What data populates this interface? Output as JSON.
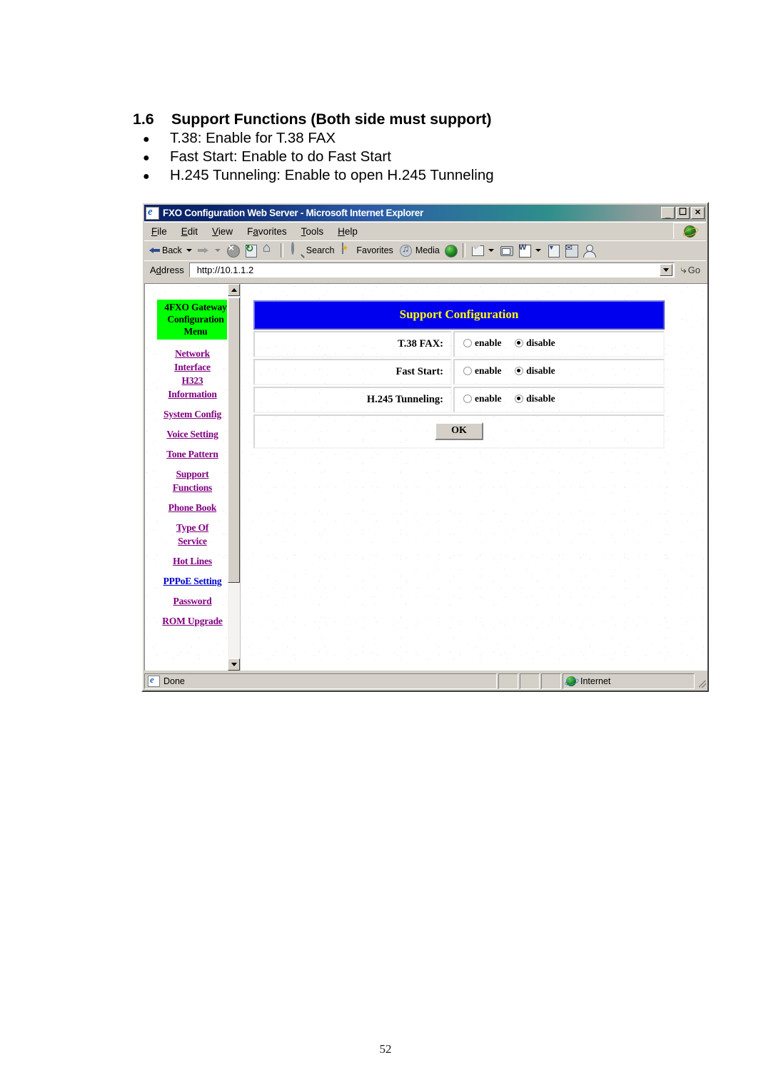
{
  "document": {
    "section_number": "1.6",
    "section_title": "Support Functions (Both side must support)",
    "bullets": [
      "T.38: Enable for T.38 FAX",
      "Fast Start: Enable to do Fast Start",
      "H.245 Tunneling: Enable to open H.245 Tunneling"
    ],
    "page_number": "52"
  },
  "browser": {
    "title": "FXO Configuration Web Server - Microsoft Internet Explorer",
    "window_buttons": {
      "minimize": "_",
      "maximize": "□",
      "close": "×"
    },
    "menu": [
      {
        "label": "File",
        "accel": "F",
        "rest": "ile"
      },
      {
        "label": "Edit",
        "accel": "E",
        "rest": "dit"
      },
      {
        "label": "View",
        "accel": "V",
        "rest": "iew"
      },
      {
        "label": "Favorites",
        "pre": "F",
        "accel": "a",
        "rest": "vorites"
      },
      {
        "label": "Tools",
        "accel": "T",
        "rest": "ools"
      },
      {
        "label": "Help",
        "accel": "H",
        "rest": "elp"
      }
    ],
    "toolbar": {
      "back_label": "Back",
      "search_label": "Search",
      "favorites_label": "Favorites",
      "media_label": "Media"
    },
    "address": {
      "label": "Address",
      "accel_pre": "A",
      "accel": "d",
      "accel_rest": "dress",
      "value": "http://10.1.1.2",
      "go_label": "Go"
    },
    "status": {
      "message": "Done",
      "zone": "Internet"
    }
  },
  "sidebar": {
    "heading_lines": [
      "4FXO Gateway",
      "Configuration",
      "Menu"
    ],
    "heading_bg": "#00ff00",
    "link_color": "#800080",
    "link_color_unvisited": "#0000cc",
    "items": [
      {
        "label": "Network",
        "color": "visited",
        "gap_after": false
      },
      {
        "label": "Interface",
        "color": "visited",
        "gap_after": false
      },
      {
        "label": "H323",
        "color": "visited",
        "gap_after": false
      },
      {
        "label": "Information",
        "color": "visited",
        "gap_after": true
      },
      {
        "label": "System Config",
        "color": "visited",
        "gap_after": true
      },
      {
        "label": "Voice Setting",
        "color": "visited",
        "gap_after": true
      },
      {
        "label": "Tone Pattern",
        "color": "visited",
        "gap_after": true
      },
      {
        "label": "Support",
        "color": "visited",
        "gap_after": false
      },
      {
        "label": "Functions",
        "color": "visited",
        "gap_after": true
      },
      {
        "label": "Phone Book",
        "color": "visited",
        "gap_after": true
      },
      {
        "label": "Type Of",
        "color": "visited",
        "gap_after": false
      },
      {
        "label": "Service",
        "color": "visited",
        "gap_after": true
      },
      {
        "label": "Hot Lines",
        "color": "visited",
        "gap_after": true
      },
      {
        "label": "PPPoE Setting",
        "color": "unvisited",
        "gap_after": true
      },
      {
        "label": "Password",
        "color": "visited",
        "gap_after": true
      },
      {
        "label": "ROM Upgrade",
        "color": "visited",
        "gap_after": false
      }
    ]
  },
  "form": {
    "header_title": "Support Configuration",
    "header_bg": "#0000ee",
    "header_fg": "#ffff00",
    "rows": [
      {
        "label": "T.38 FAX:",
        "enable_label": "enable",
        "disable_label": "disable",
        "selected": "disable"
      },
      {
        "label": "Fast Start:",
        "enable_label": "enable",
        "disable_label": "disable",
        "selected": "disable"
      },
      {
        "label": "H.245 Tunneling:",
        "enable_label": "enable",
        "disable_label": "disable",
        "selected": "disable"
      }
    ],
    "submit_label": "OK"
  }
}
